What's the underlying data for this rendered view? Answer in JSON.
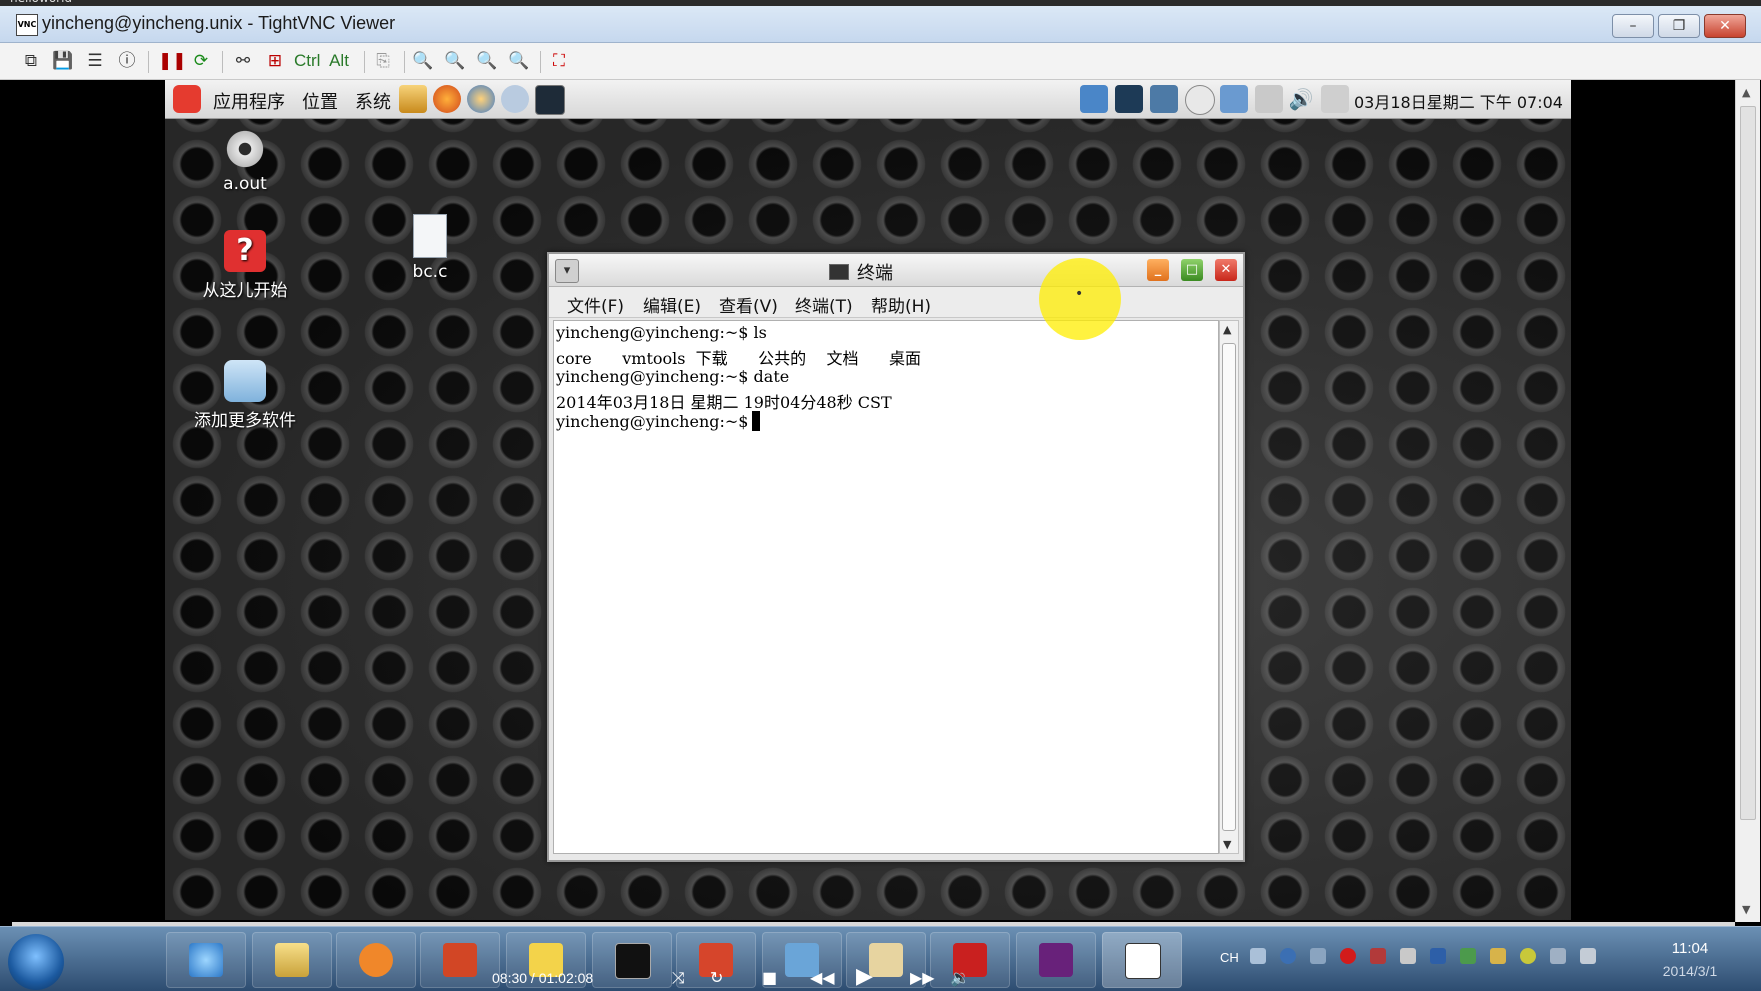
{
  "outer_strip": {
    "text": "helloworld"
  },
  "vnc": {
    "title": "yincheng@yincheng.unix - TightVNC Viewer",
    "icon_label": "VNC",
    "toolbar": {
      "ctrl_label": "Ctrl",
      "alt_label": "Alt"
    },
    "window_buttons": {
      "minimize": "–",
      "maximize": "❐",
      "close": "✕"
    }
  },
  "gnome_panel": {
    "menus": [
      "应用程序",
      "位置",
      "系统"
    ],
    "clock": "03月18日星期二 下午 07:04"
  },
  "desktop_icons": [
    {
      "label": "a.out",
      "icon": "gear-icon"
    },
    {
      "label": "从这儿开始",
      "icon": "help-icon"
    },
    {
      "label": "添加更多软件",
      "icon": "software-add-icon"
    },
    {
      "label": "bc.c",
      "icon": "text-file-icon"
    }
  ],
  "terminal": {
    "title": "终端",
    "menu": [
      "文件(F)",
      "编辑(E)",
      "查看(V)",
      "终端(T)",
      "帮助(H)"
    ],
    "lines": [
      "yincheng@yincheng:~$ ls",
      "core      vmtools  下载      公共的    文档      桌面",
      "yincheng@yincheng:~$ date",
      "2014年03月18日 星期二 19时04分48秒 CST",
      "yincheng@yincheng:~$"
    ],
    "highlight_dot": "•"
  },
  "taskbar": {
    "media_time": "08:30 / 01:02:08",
    "tray_lang": "CH",
    "clock_time": "11:04",
    "clock_date": "2014/3/1"
  },
  "colors": {
    "accent_yellow": "#ffee00",
    "taskbar_blue": "#2d4c70"
  }
}
